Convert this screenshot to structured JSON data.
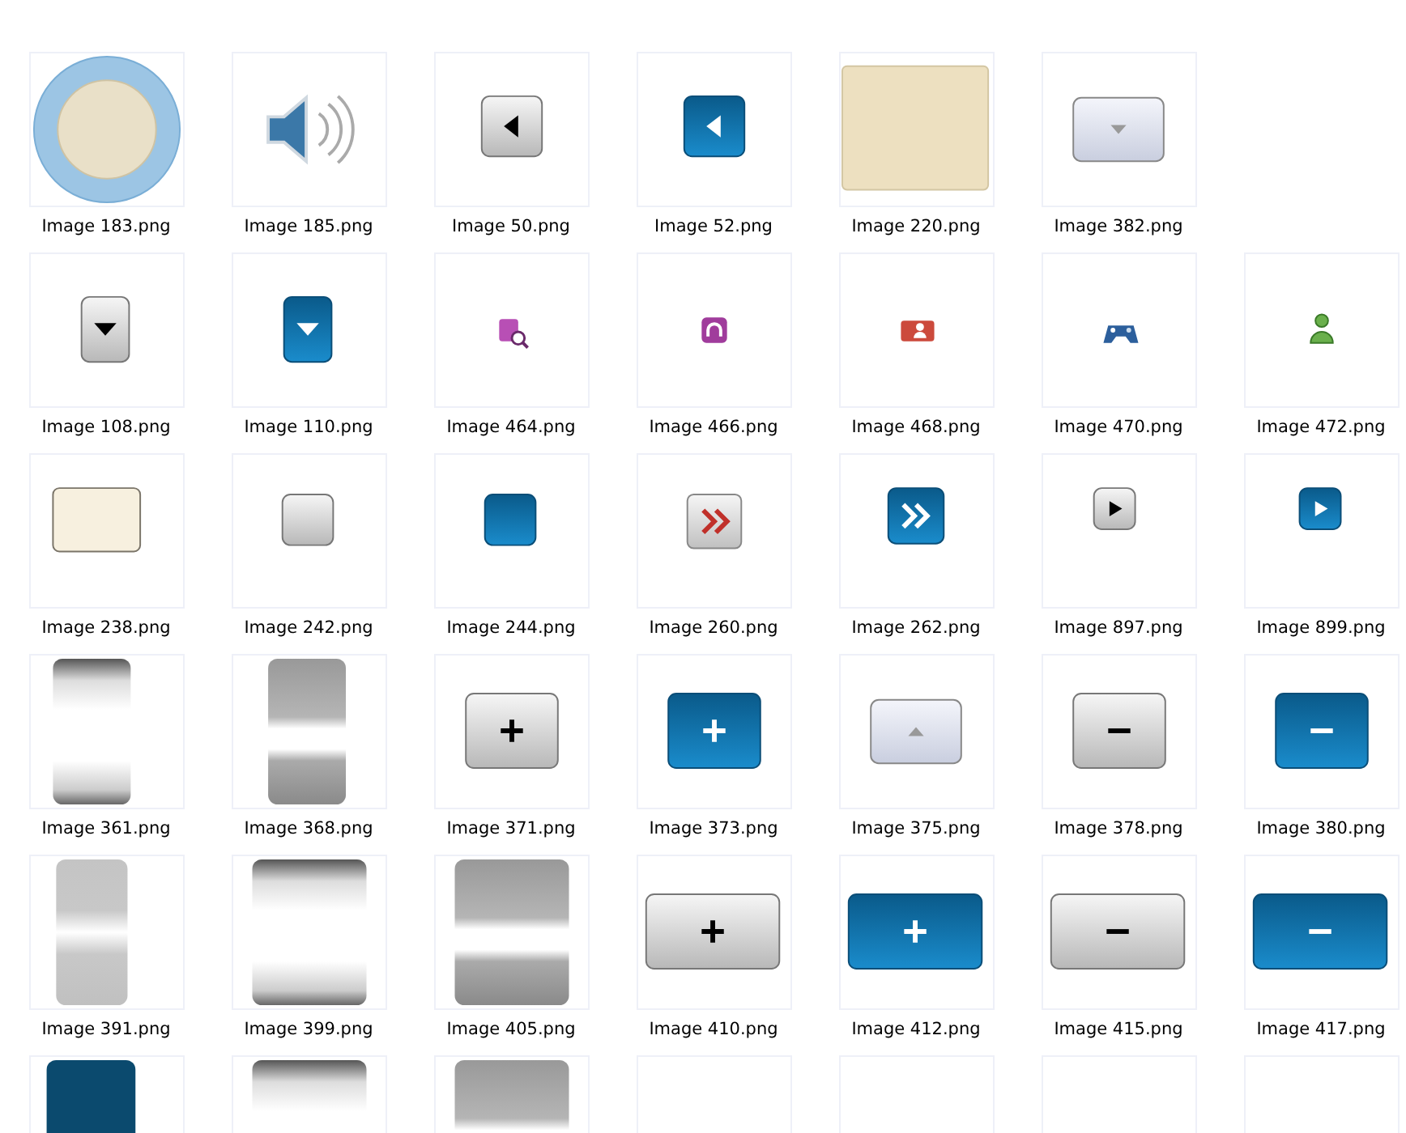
{
  "rows": [
    [
      {
        "kind": "dial",
        "label": "Image 183.png"
      },
      {
        "kind": "speaker",
        "label": "Image 185.png"
      },
      {
        "kind": "left-grey",
        "label": "Image 50.png"
      },
      {
        "kind": "left-blue",
        "label": "Image 52.png"
      },
      {
        "kind": "beige-panel",
        "label": "Image 220.png"
      },
      {
        "kind": "down-light",
        "label": "Image 382.png"
      }
    ],
    [
      {
        "kind": "down-grey",
        "label": "Image 108.png"
      },
      {
        "kind": "down-blue",
        "label": "Image 110.png"
      },
      {
        "kind": "search-doc",
        "label": "Image 464.png"
      },
      {
        "kind": "headset",
        "label": "Image 466.png"
      },
      {
        "kind": "contact-card",
        "label": "Image 468.png"
      },
      {
        "kind": "gamepad",
        "label": "Image 470.png"
      },
      {
        "kind": "user",
        "label": "Image 472.png"
      }
    ],
    [
      {
        "kind": "cream-rect",
        "label": "Image 238.png"
      },
      {
        "kind": "grey-square",
        "label": "Image 242.png"
      },
      {
        "kind": "blue-square",
        "label": "Image 244.png"
      },
      {
        "kind": "forward-grey",
        "label": "Image 260.png"
      },
      {
        "kind": "forward-blue",
        "label": "Image 262.png"
      },
      {
        "kind": "play-grey",
        "label": "Image 897.png"
      },
      {
        "kind": "play-blue",
        "label": "Image 899.png"
      }
    ],
    [
      {
        "kind": "tall-white",
        "label": "Image 361.png"
      },
      {
        "kind": "tall-band",
        "label": "Image 368.png"
      },
      {
        "kind": "plus-grey",
        "label": "Image 371.png"
      },
      {
        "kind": "plus-blue",
        "label": "Image 373.png"
      },
      {
        "kind": "up-light",
        "label": "Image 375.png"
      },
      {
        "kind": "minus-grey",
        "label": "Image 378.png"
      },
      {
        "kind": "minus-blue",
        "label": "Image 380.png"
      }
    ],
    [
      {
        "kind": "tall-grey",
        "label": "Image 391.png"
      },
      {
        "kind": "wide-white",
        "label": "Image 399.png"
      },
      {
        "kind": "wide-band",
        "label": "Image 405.png"
      },
      {
        "kind": "wide-plus-grey",
        "label": "Image 410.png"
      },
      {
        "kind": "wide-plus-blue",
        "label": "Image 412.png"
      },
      {
        "kind": "wide-minus-grey",
        "label": "Image 415.png"
      },
      {
        "kind": "wide-minus-blue",
        "label": "Image 417.png"
      }
    ],
    [
      {
        "kind": "blue-top"
      },
      {
        "kind": "wide-white"
      },
      {
        "kind": "wide-band"
      },
      {
        "kind": "empty"
      },
      {
        "kind": "empty"
      },
      {
        "kind": "empty"
      },
      {
        "kind": "empty"
      }
    ]
  ]
}
